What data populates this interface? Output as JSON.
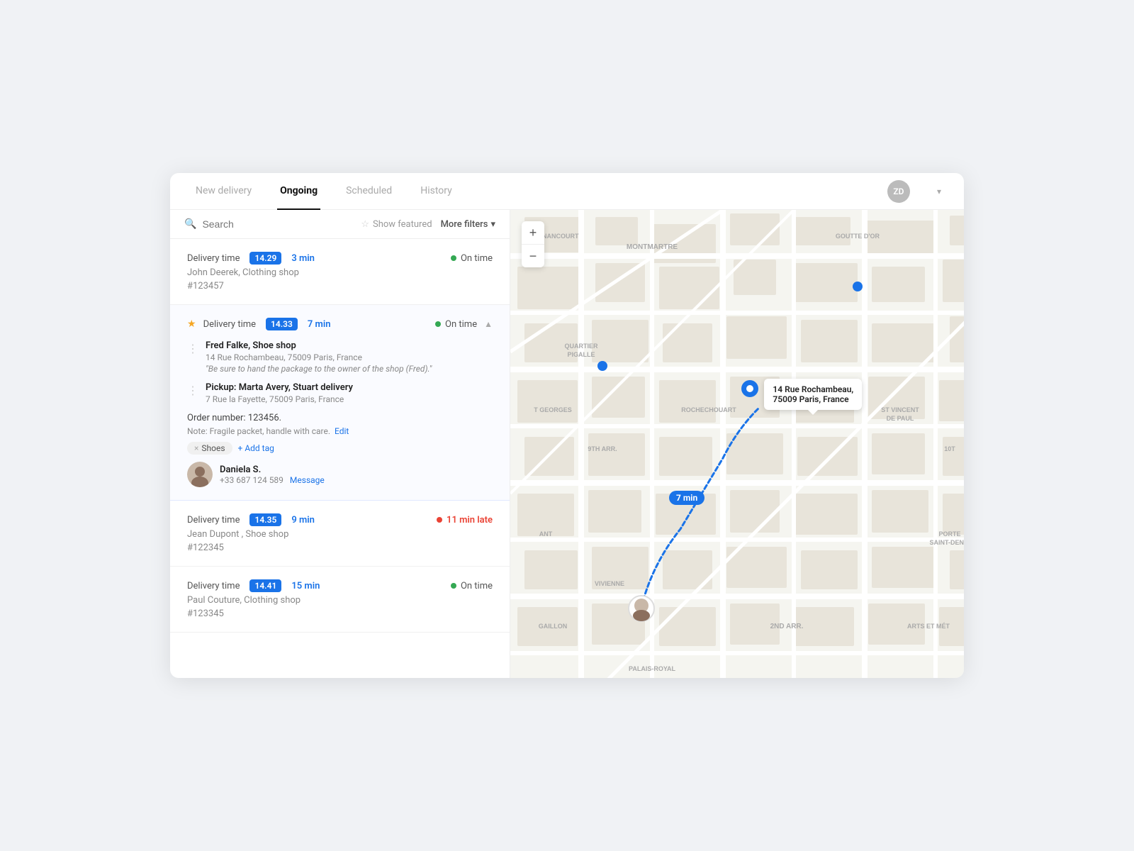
{
  "nav": {
    "tabs": [
      {
        "label": "New delivery",
        "active": false
      },
      {
        "label": "Ongoing",
        "active": true
      },
      {
        "label": "Scheduled",
        "active": false
      },
      {
        "label": "History",
        "active": false
      }
    ],
    "avatar": "ZD",
    "chevron": "▾"
  },
  "search": {
    "placeholder": "Search",
    "show_featured": "Show featured",
    "more_filters": "More filters"
  },
  "deliveries": [
    {
      "id": "d1",
      "starred": false,
      "time_label": "Delivery time",
      "time_badge": "14.29",
      "duration": "3 min",
      "status": "On time",
      "status_type": "green",
      "customer": "John Deerek, Clothing shop",
      "order_id": "#123457",
      "expanded": false
    },
    {
      "id": "d2",
      "starred": true,
      "time_label": "Delivery time",
      "time_badge": "14.33",
      "duration": "7 min",
      "status": "On time",
      "status_type": "green",
      "customer": "Fred Falke, Shoe shop",
      "order_id": "",
      "expanded": true,
      "detail": {
        "recipient_name": "Fred Falke, Shoe shop",
        "recipient_addr": "14 Rue Rochambeau, 75009 Paris, France",
        "recipient_note": "\"Be sure to hand the package to the owner of the shop (Fred).\"",
        "pickup_label": "Pickup: Marta Avery, Stuart delivery",
        "pickup_addr": "7 Rue la Fayette, 75009 Paris, France",
        "order_number": "Order number: 123456.",
        "note_label": "Note: Fragile packet, handle with care.",
        "edit": "Edit",
        "tags": [
          "Shoes"
        ],
        "add_tag": "+ Add tag",
        "driver_name": "Daniela S.",
        "driver_phone": "+33 687 124 589",
        "message": "Message"
      }
    },
    {
      "id": "d3",
      "starred": false,
      "time_label": "Delivery time",
      "time_badge": "14.35",
      "duration": "9 min",
      "status": "11 min late",
      "status_type": "red",
      "customer": "Jean Dupont , Shoe shop",
      "order_id": "#122345",
      "expanded": false
    },
    {
      "id": "d4",
      "starred": false,
      "time_label": "Delivery time",
      "time_badge": "14.41",
      "duration": "15 min",
      "status": "On time",
      "status_type": "green",
      "customer": "Paul Couture, Clothing shop",
      "order_id": "#123345",
      "expanded": false
    }
  ],
  "map": {
    "tooltip_line1": "14 Rue Rochambeau,",
    "tooltip_line2": "75009 Paris, France",
    "time_badge": "7 min",
    "zoom_in": "+",
    "zoom_out": "−"
  }
}
